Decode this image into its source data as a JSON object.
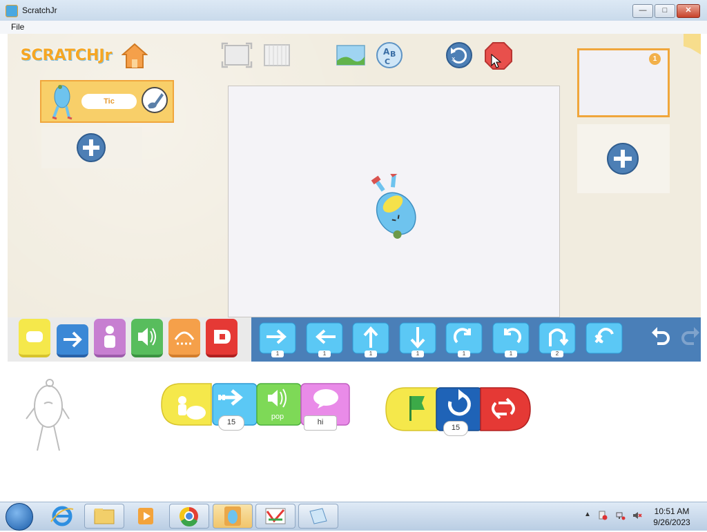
{
  "window": {
    "title": "ScratchJr",
    "minimize": "—",
    "maximize": "□",
    "close": "✕"
  },
  "menu": {
    "file": "File"
  },
  "topbar": {
    "logo": "SCRATCHJr",
    "icons": [
      "home-icon",
      "fullscreen-icon",
      "grid-icon",
      "background-icon",
      "text-icon",
      "reset-icon",
      "stop-icon"
    ]
  },
  "sprites": {
    "selected_name": "Tic"
  },
  "pages": {
    "current_page_number": "1"
  },
  "categories": [
    "triggers",
    "motion",
    "looks",
    "sound",
    "control",
    "end"
  ],
  "palette": {
    "blocks": [
      {
        "name": "move-right",
        "value": "1"
      },
      {
        "name": "move-left",
        "value": "1"
      },
      {
        "name": "move-up",
        "value": "1"
      },
      {
        "name": "move-down",
        "value": "1"
      },
      {
        "name": "turn-right",
        "value": "1"
      },
      {
        "name": "turn-left",
        "value": "1"
      },
      {
        "name": "hop",
        "value": "2"
      },
      {
        "name": "go-home",
        "value": ""
      }
    ]
  },
  "script": {
    "script1": {
      "move_value": "15",
      "sound_label": "pop",
      "say_text": "hi"
    },
    "script2": {
      "repeat_value": "15"
    }
  },
  "taskbar": {
    "time": "10:51 AM",
    "date": "9/26/2023",
    "tray_arrow": "▲"
  },
  "colors": {
    "accent_orange": "#f0a63b",
    "palette_blue": "#4a7fb8",
    "motion_block": "#4fc3f7",
    "trigger_yellow": "#f5e84b",
    "sound_green": "#58bd5d",
    "looks_purple": "#c77fd1",
    "end_red": "#e53935"
  }
}
